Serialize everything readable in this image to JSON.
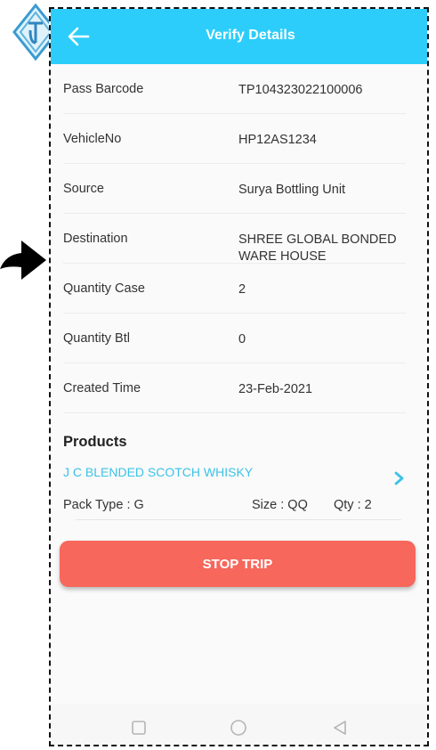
{
  "header": {
    "title": "Verify Details"
  },
  "details": [
    {
      "label": "Pass Barcode",
      "value": "TP104323022100006"
    },
    {
      "label": "VehicleNo",
      "value": "HP12AS1234"
    },
    {
      "label": "Source",
      "value": "Surya Bottling Unit"
    },
    {
      "label": "Destination",
      "value": "SHREE GLOBAL BONDED WARE HOUSE"
    },
    {
      "label": "Quantity Case",
      "value": "2"
    },
    {
      "label": "Quantity Btl",
      "value": "0"
    },
    {
      "label": "Created Time",
      "value": "23-Feb-2021"
    }
  ],
  "products": {
    "title": "Products",
    "items": [
      {
        "name": "J C BLENDED SCOTCH WHISKY",
        "pack_type": "Pack Type : G",
        "size": "Size : QQ",
        "qty": "Qty : 2"
      }
    ]
  },
  "actions": {
    "stop_trip_label": "STOP TRIP"
  },
  "colors": {
    "appbar": "#2ccdfa",
    "accent": "#3cc2e6",
    "stop_button": "#f7675c"
  },
  "icons": [
    "logo-diamond-icon",
    "arrow-right-pointer-icon",
    "back-arrow-icon",
    "chevron-right-icon",
    "nav-square-icon",
    "nav-circle-icon",
    "nav-triangle-icon"
  ]
}
